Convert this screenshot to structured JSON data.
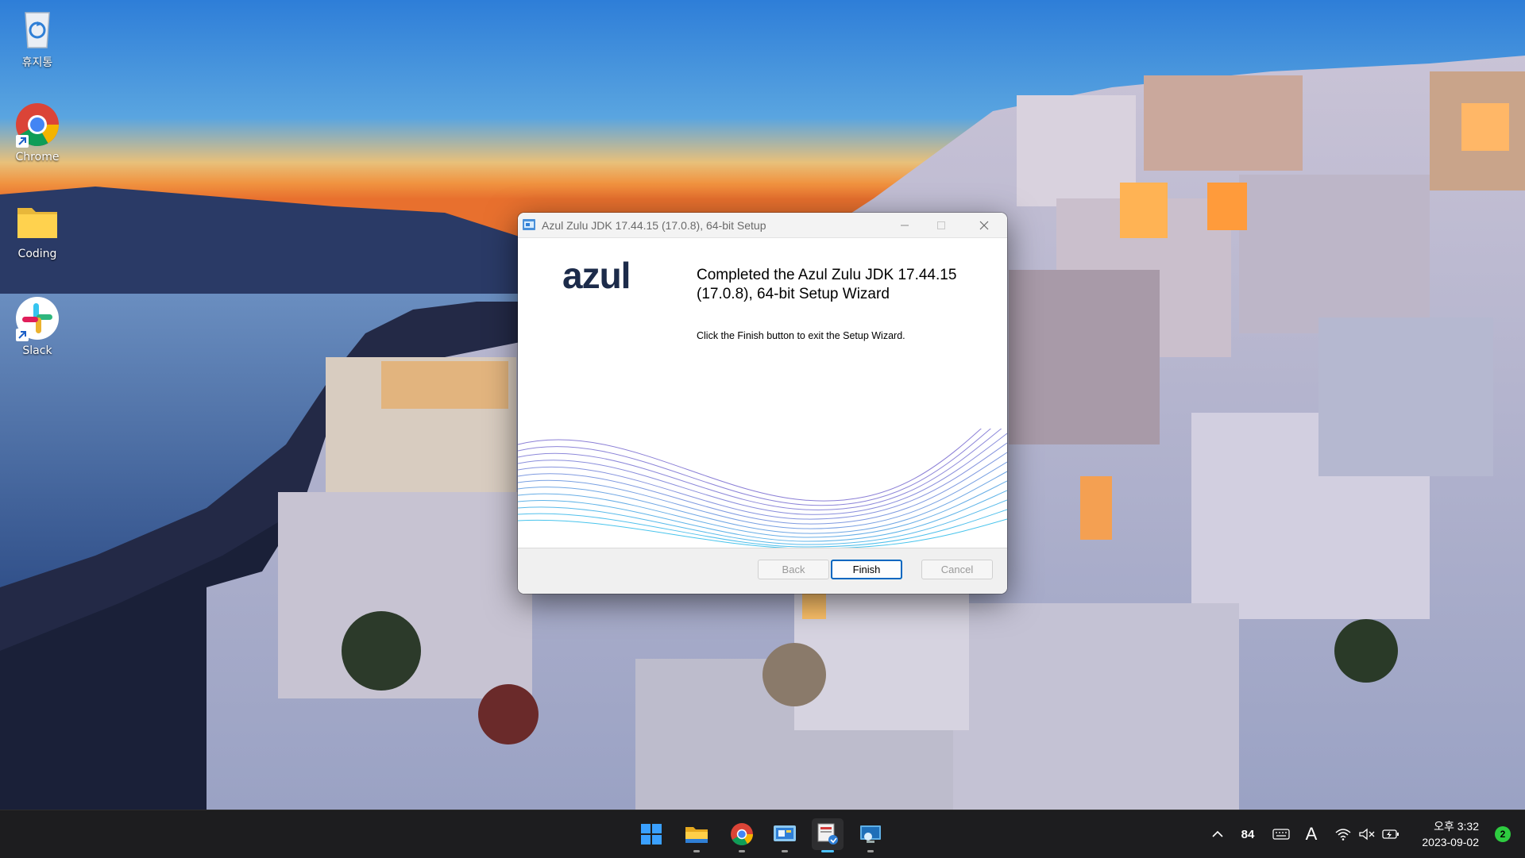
{
  "desktop": {
    "icons": [
      {
        "label": "휴지통",
        "icon": "recycle-bin-icon"
      },
      {
        "label": "Chrome",
        "icon": "chrome-icon"
      },
      {
        "label": "Coding",
        "icon": "folder-icon"
      },
      {
        "label": "Slack",
        "icon": "slack-icon"
      }
    ]
  },
  "dialog": {
    "title": "Azul Zulu JDK 17.44.15 (17.0.8), 64-bit Setup",
    "logo_text": "azul",
    "heading": "Completed the Azul Zulu JDK 17.44.15 (17.0.8), 64-bit Setup Wizard",
    "message": "Click the Finish button to exit the Setup Wizard.",
    "buttons": {
      "back": "Back",
      "finish": "Finish",
      "cancel": "Cancel"
    },
    "back_disabled": true,
    "cancel_disabled": true,
    "accent_color": "#0067c0"
  },
  "taskbar": {
    "apps": [
      {
        "name": "start",
        "icon": "windows-start-icon"
      },
      {
        "name": "file-explorer",
        "icon": "file-explorer-icon"
      },
      {
        "name": "chrome",
        "icon": "chrome-icon"
      },
      {
        "name": "control-panel",
        "icon": "control-panel-icon"
      },
      {
        "name": "installer",
        "icon": "installer-icon",
        "active": true
      },
      {
        "name": "remote-desktop",
        "icon": "remote-desktop-icon"
      }
    ],
    "tray": {
      "chevron": "^",
      "cpu_temp": "84",
      "ime": "A"
    },
    "clock": {
      "time": "오후 3:32",
      "date": "2023-09-02"
    },
    "notification_count": "2"
  }
}
